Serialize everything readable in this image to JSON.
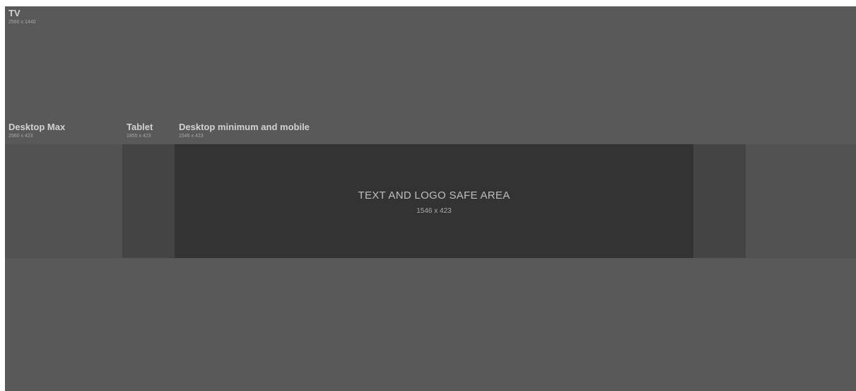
{
  "zones": {
    "tv": {
      "name": "TV",
      "dims": "2560 x 1440"
    },
    "desktop_max": {
      "name": "Desktop Max",
      "dims": "2560 x 423"
    },
    "tablet": {
      "name": "Tablet",
      "dims": "1855 x 423"
    },
    "desktop_min": {
      "name": "Desktop minimum and mobile",
      "dims": "1546 x 423"
    },
    "safe_area": {
      "title": "TEXT AND LOGO SAFE AREA",
      "dims": "1546 x 423"
    }
  },
  "colors": {
    "tv": "#595959",
    "desktop_max": "#525252",
    "tablet": "#444444",
    "safe_area": "#333333",
    "label_text": "#d2d2d2"
  }
}
